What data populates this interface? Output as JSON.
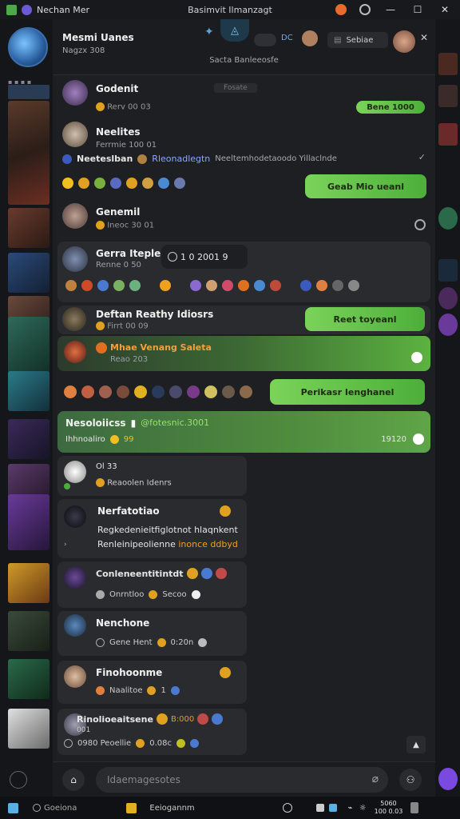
{
  "window": {
    "app_name": "Nechan Mer",
    "title": "Basimvit Ilmanzagt"
  },
  "header": {
    "name": "Mesmi Uanes",
    "subtitle": "Nagzx 308",
    "status": "Sacta Banleeosfe",
    "search_label": "Sebiae",
    "dc_label": "DC"
  },
  "messages": [
    {
      "name": "Godenit",
      "tag": "Fosate",
      "meta": "Rerv 00 03",
      "reply": "Bene 1000"
    },
    {
      "name": "Neelites",
      "meta": "Ferrmie 100 01",
      "text": "Neeteslban",
      "link": "Rleonadlegtn",
      "tail": "Neeltemhodetaoodo Yillaclnde"
    },
    {
      "reply": "Geab Mio ueanl"
    },
    {
      "name": "Genemil",
      "meta": "Ineoc 30 01"
    },
    {
      "name": "Gerra Iteplem",
      "meta": "Renne 0 50",
      "pill": "1 0 2001 9"
    },
    {
      "name": "Deftan Reathy Idiosrs",
      "meta": "Firrt 00 09",
      "reply": "Reet toyeanl"
    },
    {
      "name": "Mhae Venang Saleta",
      "meta": "Reao 203"
    },
    {
      "reply": "Perikasr Ienghanel"
    },
    {
      "name": "Nesoloiicss",
      "link": "@fotesnic.3001",
      "meta": "Ihhnoaliro",
      "count": "99",
      "time": "19120"
    },
    {
      "name": "Ol 33",
      "meta": "Reaoolen Idenrs"
    },
    {
      "name": "Nerfatotiao",
      "l1": "Regkedenieitfiglotnot hlaqnkent",
      "l2": "Renleinipeolienne",
      "l2b": "inonce ddbyd"
    },
    {
      "name": "Conleneentitintdt",
      "meta": "Onrntloo",
      "meta2": "Secoo"
    },
    {
      "name": "Nenchone",
      "meta": "Gene Hent",
      "time": "0:20n"
    },
    {
      "name": "Finohoonme",
      "meta": "Naalitoe",
      "num": "1"
    },
    {
      "name": "Rinolioeaitsene",
      "tag": "B:000",
      "line2": "001",
      "meta": "0980 Peoellie",
      "time": "0.08c"
    }
  ],
  "composer": {
    "placeholder": "Idaemagesotes"
  },
  "taskbar": {
    "search": "Goeiona",
    "app": "Eeiogannm",
    "clock": "5060",
    "date": "100 0.03"
  },
  "colors": {
    "bg": "#1e1f22",
    "green": "#6ccb4e",
    "accent": "#8aa8ff"
  }
}
